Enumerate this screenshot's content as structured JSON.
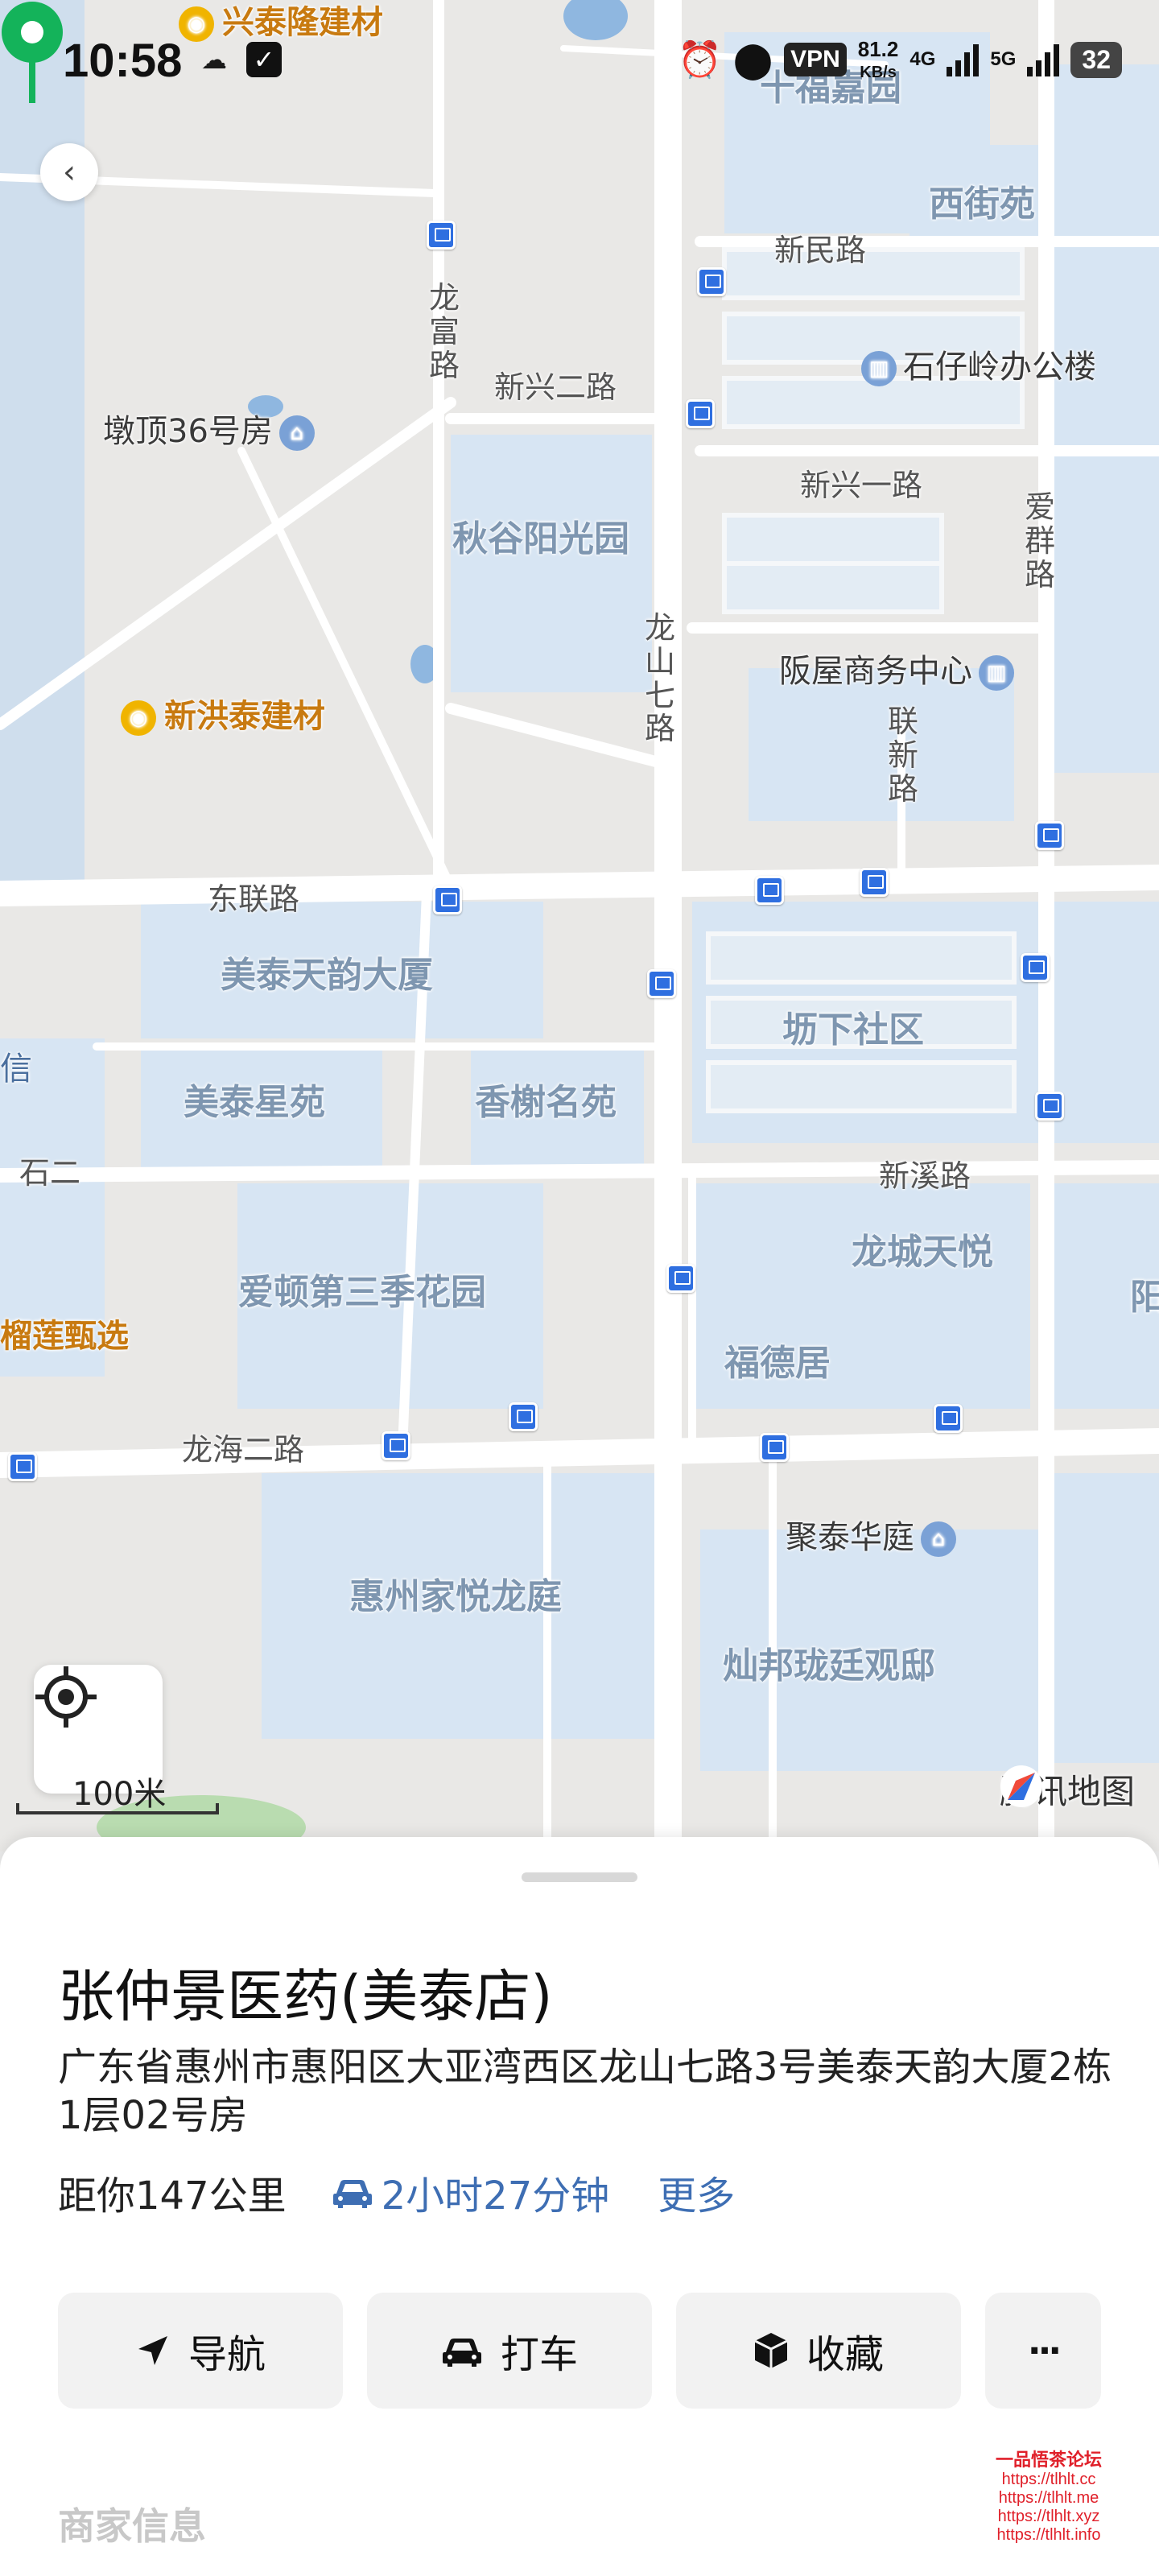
{
  "status_bar": {
    "time": "10:58",
    "vpn": "VPN",
    "speed_value": "81.2",
    "speed_unit": "KB/s",
    "net_4g": "4G",
    "net_5g": "5G",
    "battery": "32"
  },
  "map": {
    "areas": [
      {
        "id": "shifu-jiayuan",
        "text": "十福嘉园"
      },
      {
        "id": "xijie-yuan",
        "text": "西街苑"
      },
      {
        "id": "qiugu-yangguang",
        "text": "秋谷阳光园"
      },
      {
        "id": "meitai-tianyun",
        "text": "美泰天韵大厦"
      },
      {
        "id": "kanxia-shequ",
        "text": "坜下社区"
      },
      {
        "id": "meitai-xingyuan",
        "text": "美泰星苑"
      },
      {
        "id": "xiangxie-mingyuan",
        "text": "香榭名苑"
      },
      {
        "id": "aidun",
        "text": "爱顿第三季花园"
      },
      {
        "id": "longcheng",
        "text": "龙城天悦"
      },
      {
        "id": "fude",
        "text": "福德居"
      },
      {
        "id": "jiayue",
        "text": "惠州家悦龙庭"
      },
      {
        "id": "canbang",
        "text": "灿邦珑廷观邸"
      },
      {
        "id": "yang",
        "text": "阳"
      }
    ],
    "roads": [
      {
        "id": "xinmin",
        "text": "新民路"
      },
      {
        "id": "xinxing2",
        "text": "新兴二路"
      },
      {
        "id": "xinxing1",
        "text": "新兴一路"
      },
      {
        "id": "longfu",
        "text": "龙富路"
      },
      {
        "id": "longshan7",
        "text": "龙山七路"
      },
      {
        "id": "aiqun",
        "text": "爱群路"
      },
      {
        "id": "lianxin",
        "text": "联新路"
      },
      {
        "id": "donglian",
        "text": "东联路"
      },
      {
        "id": "xinxi",
        "text": "新溪路"
      },
      {
        "id": "shier",
        "text": "石二"
      },
      {
        "id": "longhai2",
        "text": "龙海二路"
      }
    ],
    "pois": [
      {
        "id": "dunding",
        "text": "墩顶36号房"
      },
      {
        "id": "shizailing",
        "text": "石仔岭办公楼"
      },
      {
        "id": "fanwu",
        "text": "阪屋商务中心"
      },
      {
        "id": "jutai",
        "text": "聚泰华庭"
      },
      {
        "id": "xin",
        "text": "信"
      }
    ],
    "shops": [
      {
        "id": "xingtailong",
        "text": "兴泰隆建材"
      },
      {
        "id": "xinhongtai",
        "text": "新洪泰建材"
      },
      {
        "id": "liulian",
        "text": "榴莲甄选"
      }
    ],
    "scale": "100米",
    "brand": "腾讯地图"
  },
  "place": {
    "title": "张仲景医药(美泰店)",
    "address": "广东省惠州市惠阳区大亚湾西区龙山七路3号美泰天韵大厦2栋1层02号房",
    "distance": "距你147公里",
    "drive_time": "2小时27分钟",
    "more": "更多"
  },
  "actions": {
    "navigate": "导航",
    "taxi": "打车",
    "favorite": "收藏",
    "more_glyph": "···"
  },
  "merchant_info_title": "商家信息",
  "watermark": {
    "title": "一品悟茶论坛",
    "links": [
      "https://tlhlt.cc",
      "https://tlhlt.me",
      "https://tlhlt.xyz",
      "https://tlhlt.info"
    ]
  },
  "colors": {
    "link_blue": "#3e6eb3",
    "pin_green": "#14b35a",
    "bus_blue": "#2f6fe0",
    "residential": "#d8e6f3"
  }
}
